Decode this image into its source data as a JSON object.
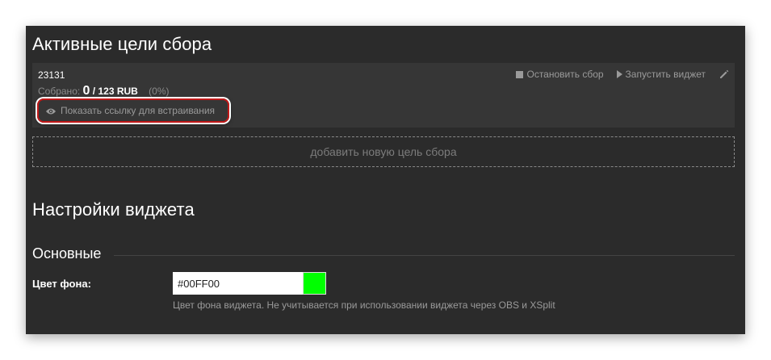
{
  "goals_section": {
    "title": "Активные цели сбора"
  },
  "goal": {
    "name": "23131",
    "collected_label": "Собрано:",
    "collected_amount": "0",
    "total": "/ 123 RUB",
    "percent": "(0%)",
    "stop_label": "Остановить сбор",
    "start_widget_label": "Запустить виджет",
    "embed_link_label": "Показать ссылку для встраивания"
  },
  "add_goal_label": "добавить новую цель сбора",
  "widget_section": {
    "title": "Настройки виджета",
    "subsection_title": "Основные"
  },
  "bg_color_field": {
    "label": "Цвет фона:",
    "value": "#00FF00",
    "swatch_color": "#00FF00",
    "help": "Цвет фона виджета. Не учитывается при использовании виджета через OBS и XSplit"
  },
  "icons": {
    "stop": "stop-icon",
    "play": "play-icon",
    "edit": "pencil-icon",
    "eye": "eye-icon"
  }
}
